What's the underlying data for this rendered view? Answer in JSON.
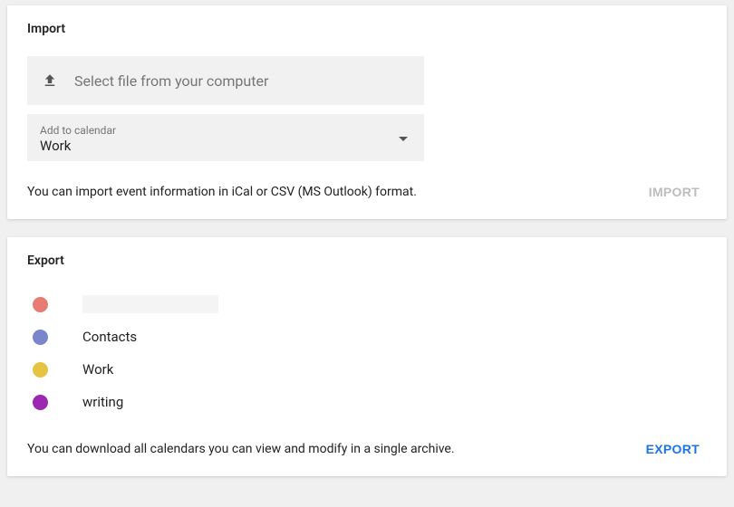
{
  "import": {
    "title": "Import",
    "file_button_label": "Select file from your computer",
    "add_to_label": "Add to calendar",
    "selected_calendar": "Work",
    "help_text": "You can import event information in iCal or CSV (MS Outlook) format.",
    "action_label": "IMPORT"
  },
  "export": {
    "title": "Export",
    "calendars": [
      {
        "color": "#e67c73",
        "name": ""
      },
      {
        "color": "#7986cb",
        "name": "Contacts"
      },
      {
        "color": "#e4c441",
        "name": "Work"
      },
      {
        "color": "#9c27b0",
        "name": "writing"
      }
    ],
    "help_text": "You can download all calendars you can view and modify in a single archive.",
    "action_label": "EXPORT"
  }
}
